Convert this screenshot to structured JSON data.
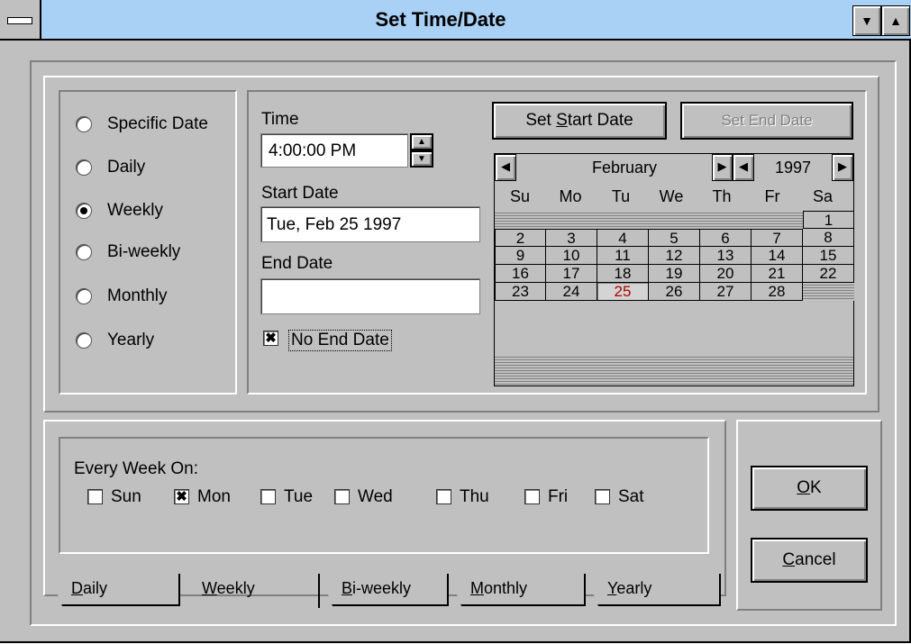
{
  "window": {
    "title": "Set Time/Date"
  },
  "frequency_options": [
    {
      "label": "Specific Date",
      "selected": false
    },
    {
      "label": "Daily",
      "selected": false
    },
    {
      "label": "Weekly",
      "selected": true
    },
    {
      "label": "Bi-weekly",
      "selected": false
    },
    {
      "label": "Monthly",
      "selected": false
    },
    {
      "label": "Yearly",
      "selected": false
    }
  ],
  "time": {
    "label": "Time",
    "value": "4:00:00 PM"
  },
  "start_date": {
    "label": "Start Date",
    "value": "Tue, Feb 25 1997"
  },
  "end_date": {
    "label": "End Date",
    "value": ""
  },
  "no_end_date": {
    "label": "No End Date",
    "checked": true
  },
  "buttons": {
    "set_start_pre": "Set ",
    "set_start_key": "S",
    "set_start_post": "tart Date",
    "set_end": "Set End Date",
    "ok_key": "O",
    "ok_post": "K",
    "cancel_key": "C",
    "cancel_post": "ancel"
  },
  "calendar": {
    "month": "February",
    "year": "1997",
    "weekdays": [
      "Su",
      "Mo",
      "Tu",
      "We",
      "Th",
      "Fr",
      "Sa"
    ],
    "weeks": [
      [
        "",
        "",
        "",
        "",
        "",
        "",
        "1"
      ],
      [
        "2",
        "3",
        "4",
        "5",
        "6",
        "7",
        "8"
      ],
      [
        "9",
        "10",
        "11",
        "12",
        "13",
        "14",
        "15"
      ],
      [
        "16",
        "17",
        "18",
        "19",
        "20",
        "21",
        "22"
      ],
      [
        "23",
        "24",
        "25",
        "26",
        "27",
        "28",
        ""
      ]
    ],
    "selected_day": "25",
    "selected_color": "#b00000"
  },
  "weekly": {
    "label": "Every Week On:",
    "days": [
      {
        "label": "Sun",
        "checked": false
      },
      {
        "label": "Mon",
        "checked": true
      },
      {
        "label": "Tue",
        "checked": false
      },
      {
        "label": "Wed",
        "checked": false
      },
      {
        "label": "Thu",
        "checked": false
      },
      {
        "label": "Fri",
        "checked": false
      },
      {
        "label": "Sat",
        "checked": false
      }
    ]
  },
  "tabs": [
    {
      "key": "D",
      "rest": "aily"
    },
    {
      "key": "W",
      "rest": "eekly"
    },
    {
      "key": "B",
      "rest": "i-weekly"
    },
    {
      "key": "M",
      "rest": "onthly"
    },
    {
      "key": "Y",
      "rest": "early"
    }
  ],
  "active_tab": "Weekly",
  "checkmark_glyph": "✖",
  "colors": {
    "titlebar": "#a8d1f5",
    "face": "#c0c0c0"
  }
}
